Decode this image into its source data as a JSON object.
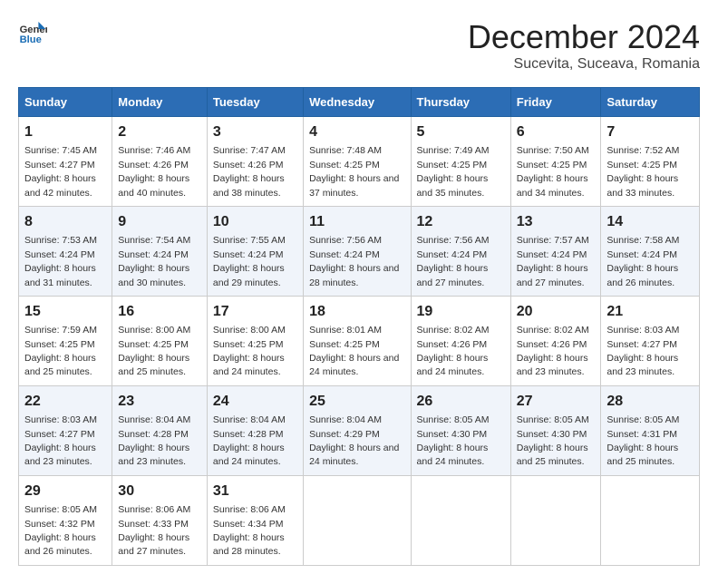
{
  "logo": {
    "line1": "General",
    "line2": "Blue"
  },
  "title": "December 2024",
  "subtitle": "Sucevita, Suceava, Romania",
  "headers": [
    "Sunday",
    "Monday",
    "Tuesday",
    "Wednesday",
    "Thursday",
    "Friday",
    "Saturday"
  ],
  "weeks": [
    [
      {
        "day": "1",
        "sunrise": "7:45 AM",
        "sunset": "4:27 PM",
        "daylight": "8 hours and 42 minutes."
      },
      {
        "day": "2",
        "sunrise": "7:46 AM",
        "sunset": "4:26 PM",
        "daylight": "8 hours and 40 minutes."
      },
      {
        "day": "3",
        "sunrise": "7:47 AM",
        "sunset": "4:26 PM",
        "daylight": "8 hours and 38 minutes."
      },
      {
        "day": "4",
        "sunrise": "7:48 AM",
        "sunset": "4:25 PM",
        "daylight": "8 hours and 37 minutes."
      },
      {
        "day": "5",
        "sunrise": "7:49 AM",
        "sunset": "4:25 PM",
        "daylight": "8 hours and 35 minutes."
      },
      {
        "day": "6",
        "sunrise": "7:50 AM",
        "sunset": "4:25 PM",
        "daylight": "8 hours and 34 minutes."
      },
      {
        "day": "7",
        "sunrise": "7:52 AM",
        "sunset": "4:25 PM",
        "daylight": "8 hours and 33 minutes."
      }
    ],
    [
      {
        "day": "8",
        "sunrise": "7:53 AM",
        "sunset": "4:24 PM",
        "daylight": "8 hours and 31 minutes."
      },
      {
        "day": "9",
        "sunrise": "7:54 AM",
        "sunset": "4:24 PM",
        "daylight": "8 hours and 30 minutes."
      },
      {
        "day": "10",
        "sunrise": "7:55 AM",
        "sunset": "4:24 PM",
        "daylight": "8 hours and 29 minutes."
      },
      {
        "day": "11",
        "sunrise": "7:56 AM",
        "sunset": "4:24 PM",
        "daylight": "8 hours and 28 minutes."
      },
      {
        "day": "12",
        "sunrise": "7:56 AM",
        "sunset": "4:24 PM",
        "daylight": "8 hours and 27 minutes."
      },
      {
        "day": "13",
        "sunrise": "7:57 AM",
        "sunset": "4:24 PM",
        "daylight": "8 hours and 27 minutes."
      },
      {
        "day": "14",
        "sunrise": "7:58 AM",
        "sunset": "4:24 PM",
        "daylight": "8 hours and 26 minutes."
      }
    ],
    [
      {
        "day": "15",
        "sunrise": "7:59 AM",
        "sunset": "4:25 PM",
        "daylight": "8 hours and 25 minutes."
      },
      {
        "day": "16",
        "sunrise": "8:00 AM",
        "sunset": "4:25 PM",
        "daylight": "8 hours and 25 minutes."
      },
      {
        "day": "17",
        "sunrise": "8:00 AM",
        "sunset": "4:25 PM",
        "daylight": "8 hours and 24 minutes."
      },
      {
        "day": "18",
        "sunrise": "8:01 AM",
        "sunset": "4:25 PM",
        "daylight": "8 hours and 24 minutes."
      },
      {
        "day": "19",
        "sunrise": "8:02 AM",
        "sunset": "4:26 PM",
        "daylight": "8 hours and 24 minutes."
      },
      {
        "day": "20",
        "sunrise": "8:02 AM",
        "sunset": "4:26 PM",
        "daylight": "8 hours and 23 minutes."
      },
      {
        "day": "21",
        "sunrise": "8:03 AM",
        "sunset": "4:27 PM",
        "daylight": "8 hours and 23 minutes."
      }
    ],
    [
      {
        "day": "22",
        "sunrise": "8:03 AM",
        "sunset": "4:27 PM",
        "daylight": "8 hours and 23 minutes."
      },
      {
        "day": "23",
        "sunrise": "8:04 AM",
        "sunset": "4:28 PM",
        "daylight": "8 hours and 23 minutes."
      },
      {
        "day": "24",
        "sunrise": "8:04 AM",
        "sunset": "4:28 PM",
        "daylight": "8 hours and 24 minutes."
      },
      {
        "day": "25",
        "sunrise": "8:04 AM",
        "sunset": "4:29 PM",
        "daylight": "8 hours and 24 minutes."
      },
      {
        "day": "26",
        "sunrise": "8:05 AM",
        "sunset": "4:30 PM",
        "daylight": "8 hours and 24 minutes."
      },
      {
        "day": "27",
        "sunrise": "8:05 AM",
        "sunset": "4:30 PM",
        "daylight": "8 hours and 25 minutes."
      },
      {
        "day": "28",
        "sunrise": "8:05 AM",
        "sunset": "4:31 PM",
        "daylight": "8 hours and 25 minutes."
      }
    ],
    [
      {
        "day": "29",
        "sunrise": "8:05 AM",
        "sunset": "4:32 PM",
        "daylight": "8 hours and 26 minutes."
      },
      {
        "day": "30",
        "sunrise": "8:06 AM",
        "sunset": "4:33 PM",
        "daylight": "8 hours and 27 minutes."
      },
      {
        "day": "31",
        "sunrise": "8:06 AM",
        "sunset": "4:34 PM",
        "daylight": "8 hours and 28 minutes."
      },
      null,
      null,
      null,
      null
    ]
  ]
}
